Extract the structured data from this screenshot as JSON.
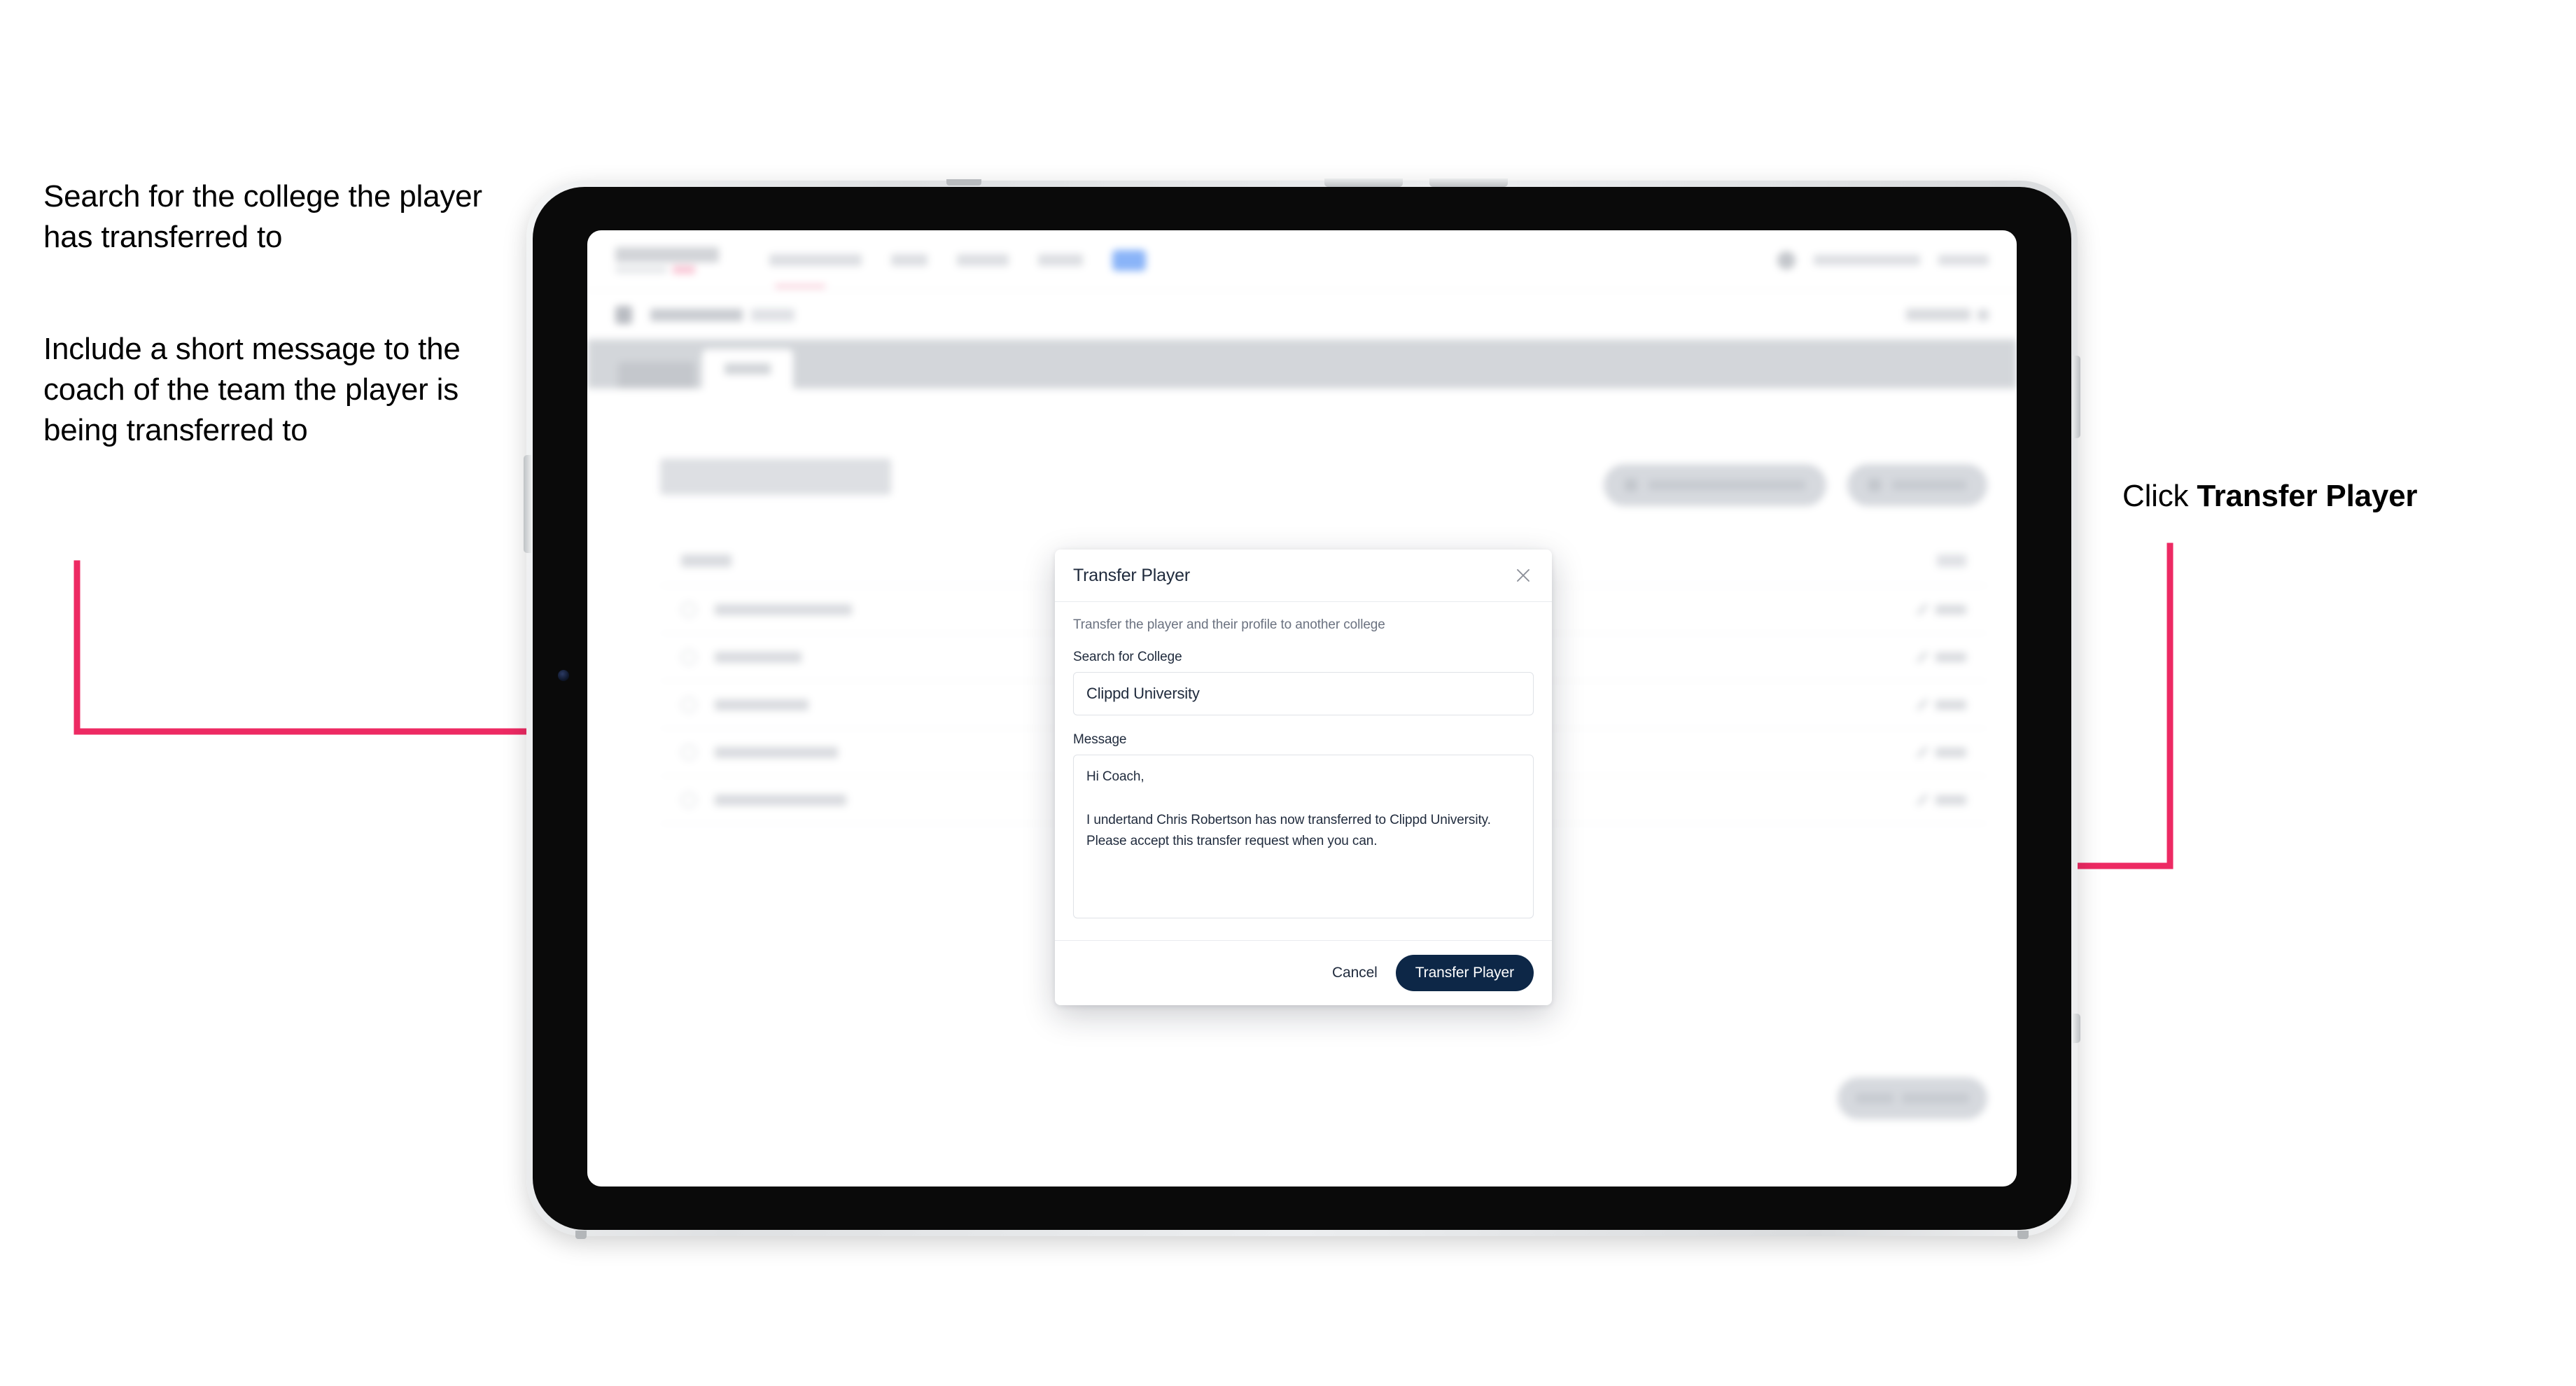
{
  "annotations": {
    "left_1": "Search for the college the player has transferred to",
    "left_2": "Include a short message to the coach of the team the player is being transferred to",
    "right_1_prefix": "Click ",
    "right_1_bold": "Transfer Player",
    "arrow_color": "#ed2a63"
  },
  "device": {
    "type": "tablet",
    "orientation": "landscape"
  },
  "modal": {
    "title": "Transfer Player",
    "close_icon": "close-icon",
    "description": "Transfer the player and their profile to another college",
    "college": {
      "label": "Search for College",
      "value": "Clippd University",
      "placeholder": "Search for College"
    },
    "message": {
      "label": "Message",
      "value": "Hi Coach,\n\nI undertand Chris Robertson has now transferred to Clippd University. Please accept this transfer request when you can.",
      "placeholder": "Message"
    },
    "cancel_label": "Cancel",
    "submit_label": "Transfer Player",
    "submit_color": "#0d2747"
  },
  "app_background": {
    "note": "blurred underlying page",
    "page_title": "Update Roster",
    "brand": "SCOREBOARD",
    "nav_items": [
      "TOURNAMENTS",
      "TEAM",
      "RANKINGS",
      "ANALYTICS"
    ],
    "nav_active_pill": "",
    "breadcrumb": [
      "Scoreboard",
      "Edit"
    ],
    "breadcrumb_action": "Cancel",
    "tabs": [
      "Details",
      "Roster"
    ],
    "active_tab": "Roster",
    "toolbar_buttons": [
      "Request Player Transfer",
      "Add Player"
    ],
    "table_header": [
      "Email",
      "EDIT"
    ],
    "rows": [
      {
        "name": "Chris Robertson",
        "action": "Edit"
      },
      {
        "name": "Ian Wilson",
        "action": "Edit"
      },
      {
        "name": "John Taylor",
        "action": "Edit"
      },
      {
        "name": "Lewis Thornton",
        "action": "Edit"
      },
      {
        "name": "Nathan Andrews",
        "action": "Edit"
      }
    ],
    "bottom_cta": "Save Roster Changes"
  }
}
